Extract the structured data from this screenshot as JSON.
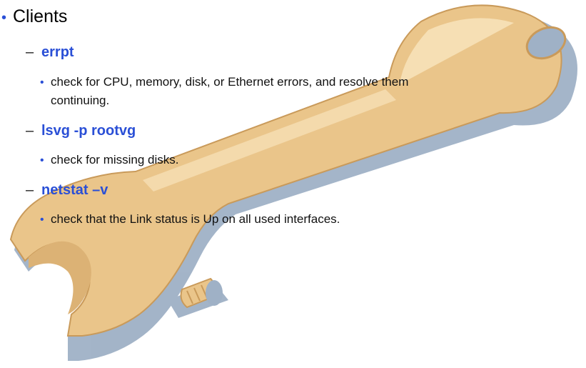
{
  "heading": {
    "bullet": "•",
    "label": "Clients"
  },
  "items": [
    {
      "dash": "–",
      "command": "errpt",
      "bullet": "•",
      "detail_line1": "check for CPU, memory, disk, or Ethernet errors, and resolve them",
      "detail_line2": "continuing."
    },
    {
      "dash": "–",
      "command": "lsvg -p rootvg",
      "bullet": "•",
      "detail_line1": "check for missing disks."
    },
    {
      "dash": "–",
      "command": "netstat –v",
      "bullet": "•",
      "detail_line1": "check that the Link status is Up on all used interfaces."
    }
  ],
  "illustration": {
    "icon": "wrench-icon",
    "colors": {
      "body": "#eac58a",
      "highlight": "#f6dfb4",
      "outline": "#c99a5a",
      "shadow": "#9fb1c6",
      "hole": "#9fb1c6"
    }
  }
}
